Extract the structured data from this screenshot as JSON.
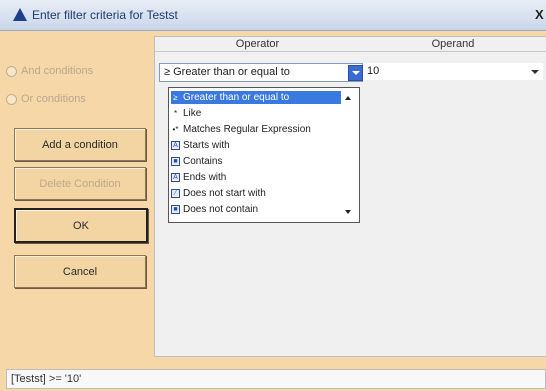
{
  "window": {
    "title": "Enter filter criteria for Testst",
    "close_label": "X"
  },
  "options": {
    "and_label": "And conditions",
    "or_label": "Or conditions"
  },
  "buttons": {
    "add": "Add a condition",
    "delete": "Delete Condition",
    "ok": "OK",
    "cancel": "Cancel"
  },
  "grid": {
    "headers": {
      "operator": "Operator",
      "operand": "Operand"
    },
    "row": {
      "operator_display": "≥  Greater than or equal to",
      "operand_value": "10"
    }
  },
  "dropdown": {
    "items": [
      {
        "icon": "≥",
        "label": "Greater than or equal to",
        "selected": true
      },
      {
        "icon": "*",
        "label": "Like",
        "selected": false
      },
      {
        "icon": "•*",
        "label": "Matches Regular Expression",
        "selected": false
      },
      {
        "icon": "A",
        "label": "Starts with",
        "selected": false
      },
      {
        "icon": "■",
        "label": "Contains",
        "selected": false
      },
      {
        "icon": "A",
        "label": "Ends with",
        "selected": false
      },
      {
        "icon": "⁄",
        "label": "Does not start with",
        "selected": false
      },
      {
        "icon": "■",
        "label": "Does not contain",
        "selected": false
      }
    ]
  },
  "status": {
    "expression": "[Testst] >= '10'"
  }
}
